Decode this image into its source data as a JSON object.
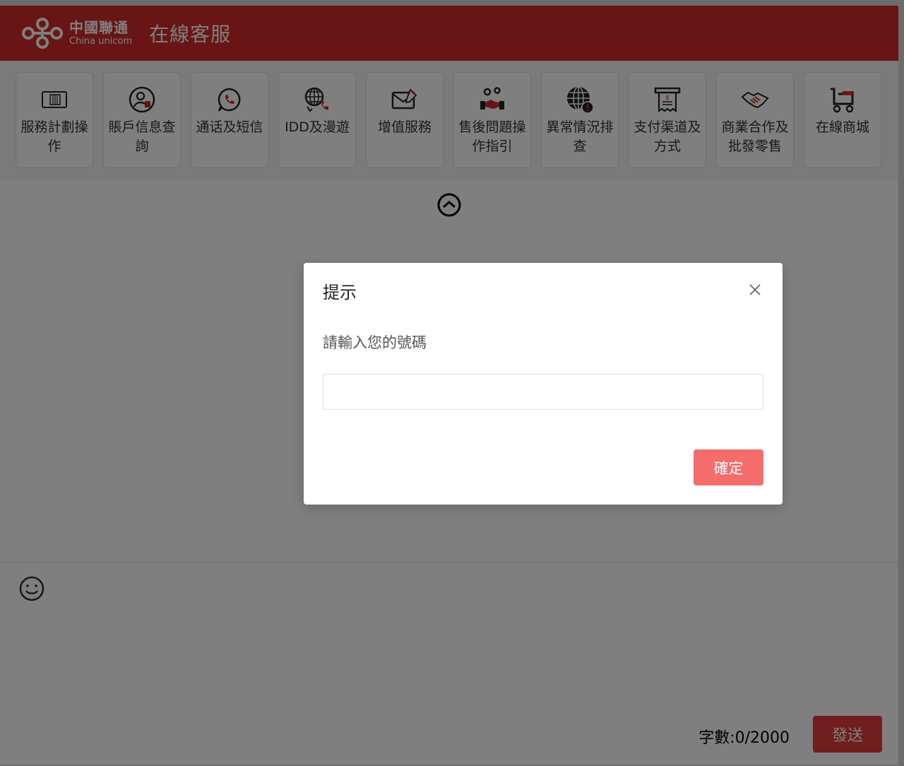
{
  "header": {
    "logo_cn": "中國聯通",
    "logo_en": "China unicom",
    "title": "在線客服",
    "color": "#d22b2b"
  },
  "menu": {
    "items": [
      {
        "label": "服務計劃操作",
        "icon": "sim-card-icon"
      },
      {
        "label": "賬戶信息查詢",
        "icon": "account-user-icon"
      },
      {
        "label": "通话及短信",
        "icon": "phone-chat-icon"
      },
      {
        "label": "IDD及漫遊",
        "icon": "globe-phone-icon"
      },
      {
        "label": "增值服務",
        "icon": "mail-edit-icon"
      },
      {
        "label": "售後問題操作指引",
        "icon": "support-handshake-icon"
      },
      {
        "label": "異常情況排查",
        "icon": "globe-alert-icon"
      },
      {
        "label": "支付渠道及方式",
        "icon": "receipt-icon"
      },
      {
        "label": "商業合作及批發零售",
        "icon": "handshake-icon"
      },
      {
        "label": "在線商城",
        "icon": "shopping-cart-icon"
      }
    ]
  },
  "input_area": {
    "char_count": "字數:0/2000",
    "send_label": "發送"
  },
  "dialog": {
    "title": "提示",
    "message": "請輸入您的號碼",
    "input_value": "",
    "confirm_label": "確定",
    "confirm_color": "#f56c6c"
  }
}
